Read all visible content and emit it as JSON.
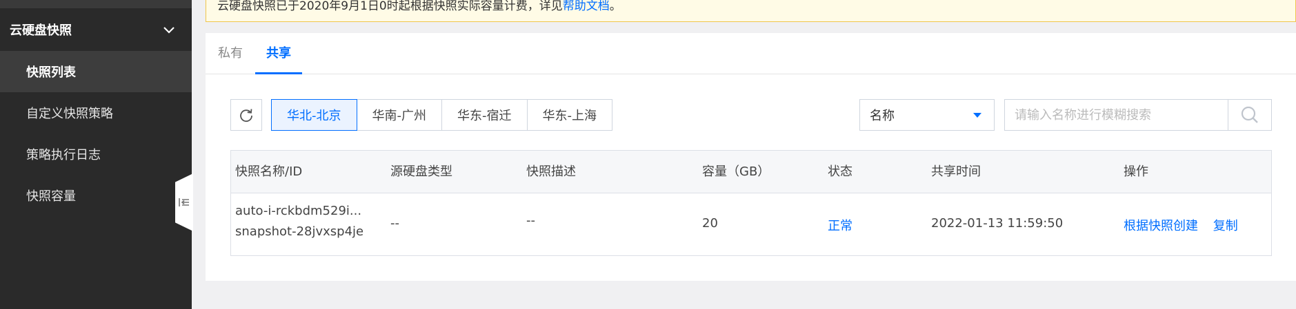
{
  "sidebar": {
    "group_title": "云硬盘快照",
    "items": [
      {
        "label": "快照列表",
        "active": true
      },
      {
        "label": "自定义快照策略",
        "active": false
      },
      {
        "label": "策略执行日志",
        "active": false
      },
      {
        "label": "快照容量",
        "active": false
      }
    ]
  },
  "notice": {
    "text": "云硬盘快照已于2020年9月1日0时起根据快照实际容量计费，详见",
    "link": "帮助文档",
    "suffix": "。"
  },
  "tabs": [
    {
      "label": "私有",
      "active": false
    },
    {
      "label": "共享",
      "active": true
    }
  ],
  "toolbar": {
    "regions": [
      "华北-北京",
      "华南-广州",
      "华东-宿迁",
      "华东-上海"
    ],
    "active_region": "华北-北京",
    "filter_select": "名称",
    "search_placeholder": "请输入名称进行模糊搜索"
  },
  "table": {
    "columns": [
      "快照名称/ID",
      "源硬盘类型",
      "快照描述",
      "容量（GB）",
      "状态",
      "共享时间",
      "操作"
    ],
    "rows": [
      {
        "name": "auto-i-rckbdm529i...",
        "id": "snapshot-28jvxsp4je",
        "disk_type": "--",
        "description": "--",
        "capacity": "20",
        "status": "正常",
        "share_time": "2022-01-13 11:59:50",
        "actions": [
          "根据快照创建",
          "复制"
        ]
      }
    ]
  },
  "colors": {
    "accent": "#006eff",
    "sidebar_bg": "#2a2a2a"
  }
}
